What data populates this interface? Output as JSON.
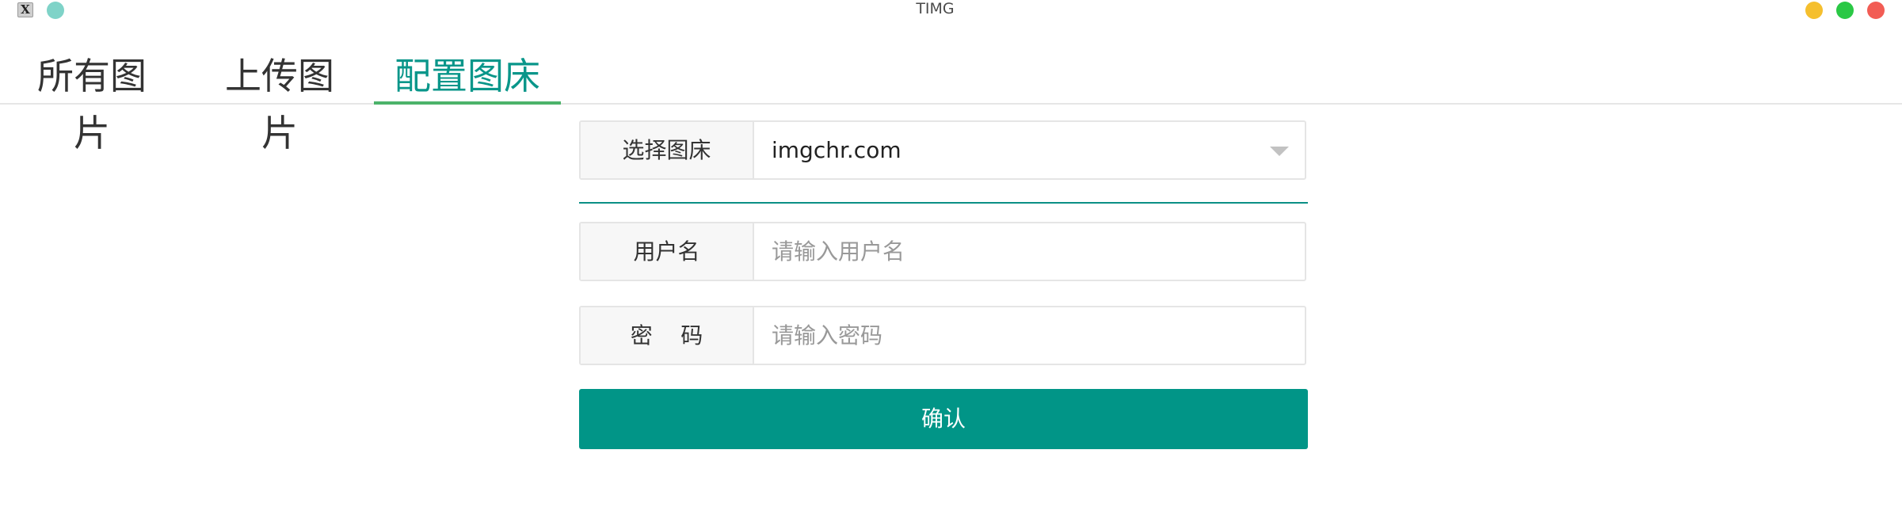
{
  "window": {
    "title": "TIMG",
    "app_icon": "x-app-icon",
    "buttons": [
      {
        "name": "minimize",
        "color": "#f5bf2e"
      },
      {
        "name": "maximize",
        "color": "#2ac845"
      },
      {
        "name": "close",
        "color": "#f25c54"
      }
    ]
  },
  "tabs": [
    {
      "label": "所有图片",
      "active": false
    },
    {
      "label": "上传图片",
      "active": false
    },
    {
      "label": "配置图床",
      "active": true
    }
  ],
  "form": {
    "host": {
      "label": "选择图床",
      "value": "imgchr.com",
      "icon": "chevron-down-icon"
    },
    "username": {
      "label": "用户名",
      "placeholder": "请输入用户名",
      "value": ""
    },
    "password": {
      "label": "密    码",
      "placeholder": "请输入密码",
      "value": ""
    },
    "confirm_label": "确认"
  },
  "colors": {
    "accent": "#019587",
    "active_tab_text": "#09968a",
    "active_tab_underline": "#4cb36a"
  }
}
